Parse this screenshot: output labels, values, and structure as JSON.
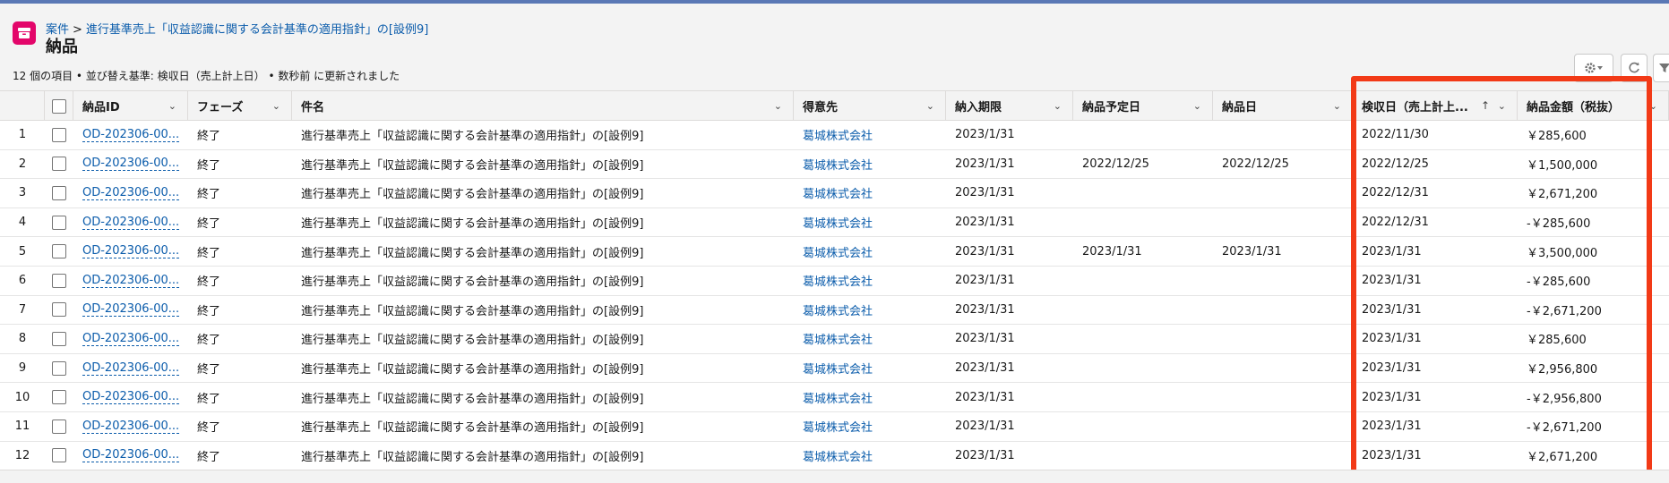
{
  "header": {
    "breadcrumb_parent": "案件",
    "breadcrumb_sep": ">",
    "breadcrumb_current": "進行基準売上「収益認識に関する会計基準の適用指針」の[設例9]",
    "title": "納品",
    "meta": "12 個の項目 • 並び替え基準: 検収日（売上計上日） • 数秒前 に更新されました"
  },
  "colors": {
    "accent": "#e3066a",
    "link": "#0b5cab",
    "highlight": "#f23a17"
  },
  "icons": {
    "object": "archive-box-icon",
    "gear": "gear-icon",
    "refresh": "refresh-icon",
    "filter": "filter-icon"
  },
  "table": {
    "columns": [
      "納品ID",
      "フェーズ",
      "件名",
      "得意先",
      "納入期限",
      "納品予定日",
      "納品日",
      "検収日（売上計上...",
      "納品金額（税抜）"
    ],
    "sort_indicator": "↑",
    "rows": [
      {
        "n": "1",
        "id": "OD-202306-00...",
        "phase": "終了",
        "subject": "進行基準売上「収益認識に関する会計基準の適用指針」の[設例9]",
        "customer": "葛城株式会社",
        "deadline": "2023/1/31",
        "planned": "",
        "delivered": "",
        "accepted": "2022/11/30",
        "amount": "￥285,600"
      },
      {
        "n": "2",
        "id": "OD-202306-00...",
        "phase": "終了",
        "subject": "進行基準売上「収益認識に関する会計基準の適用指針」の[設例9]",
        "customer": "葛城株式会社",
        "deadline": "2023/1/31",
        "planned": "2022/12/25",
        "delivered": "2022/12/25",
        "accepted": "2022/12/25",
        "amount": "￥1,500,000"
      },
      {
        "n": "3",
        "id": "OD-202306-00...",
        "phase": "終了",
        "subject": "進行基準売上「収益認識に関する会計基準の適用指針」の[設例9]",
        "customer": "葛城株式会社",
        "deadline": "2023/1/31",
        "planned": "",
        "delivered": "",
        "accepted": "2022/12/31",
        "amount": "￥2,671,200"
      },
      {
        "n": "4",
        "id": "OD-202306-00...",
        "phase": "終了",
        "subject": "進行基準売上「収益認識に関する会計基準の適用指針」の[設例9]",
        "customer": "葛城株式会社",
        "deadline": "2023/1/31",
        "planned": "",
        "delivered": "",
        "accepted": "2022/12/31",
        "amount": "-￥285,600"
      },
      {
        "n": "5",
        "id": "OD-202306-00...",
        "phase": "終了",
        "subject": "進行基準売上「収益認識に関する会計基準の適用指針」の[設例9]",
        "customer": "葛城株式会社",
        "deadline": "2023/1/31",
        "planned": "2023/1/31",
        "delivered": "2023/1/31",
        "accepted": "2023/1/31",
        "amount": "￥3,500,000"
      },
      {
        "n": "6",
        "id": "OD-202306-00...",
        "phase": "終了",
        "subject": "進行基準売上「収益認識に関する会計基準の適用指針」の[設例9]",
        "customer": "葛城株式会社",
        "deadline": "2023/1/31",
        "planned": "",
        "delivered": "",
        "accepted": "2023/1/31",
        "amount": "-￥285,600"
      },
      {
        "n": "7",
        "id": "OD-202306-00...",
        "phase": "終了",
        "subject": "進行基準売上「収益認識に関する会計基準の適用指針」の[設例9]",
        "customer": "葛城株式会社",
        "deadline": "2023/1/31",
        "planned": "",
        "delivered": "",
        "accepted": "2023/1/31",
        "amount": "-￥2,671,200"
      },
      {
        "n": "8",
        "id": "OD-202306-00...",
        "phase": "終了",
        "subject": "進行基準売上「収益認識に関する会計基準の適用指針」の[設例9]",
        "customer": "葛城株式会社",
        "deadline": "2023/1/31",
        "planned": "",
        "delivered": "",
        "accepted": "2023/1/31",
        "amount": "￥285,600"
      },
      {
        "n": "9",
        "id": "OD-202306-00...",
        "phase": "終了",
        "subject": "進行基準売上「収益認識に関する会計基準の適用指針」の[設例9]",
        "customer": "葛城株式会社",
        "deadline": "2023/1/31",
        "planned": "",
        "delivered": "",
        "accepted": "2023/1/31",
        "amount": "￥2,956,800"
      },
      {
        "n": "10",
        "id": "OD-202306-00...",
        "phase": "終了",
        "subject": "進行基準売上「収益認識に関する会計基準の適用指針」の[設例9]",
        "customer": "葛城株式会社",
        "deadline": "2023/1/31",
        "planned": "",
        "delivered": "",
        "accepted": "2023/1/31",
        "amount": "-￥2,956,800"
      },
      {
        "n": "11",
        "id": "OD-202306-00...",
        "phase": "終了",
        "subject": "進行基準売上「収益認識に関する会計基準の適用指針」の[設例9]",
        "customer": "葛城株式会社",
        "deadline": "2023/1/31",
        "planned": "",
        "delivered": "",
        "accepted": "2023/1/31",
        "amount": "-￥2,671,200"
      },
      {
        "n": "12",
        "id": "OD-202306-00...",
        "phase": "終了",
        "subject": "進行基準売上「収益認識に関する会計基準の適用指針」の[設例9]",
        "customer": "葛城株式会社",
        "deadline": "2023/1/31",
        "planned": "",
        "delivered": "",
        "accepted": "2023/1/31",
        "amount": "￥2,671,200"
      }
    ]
  }
}
